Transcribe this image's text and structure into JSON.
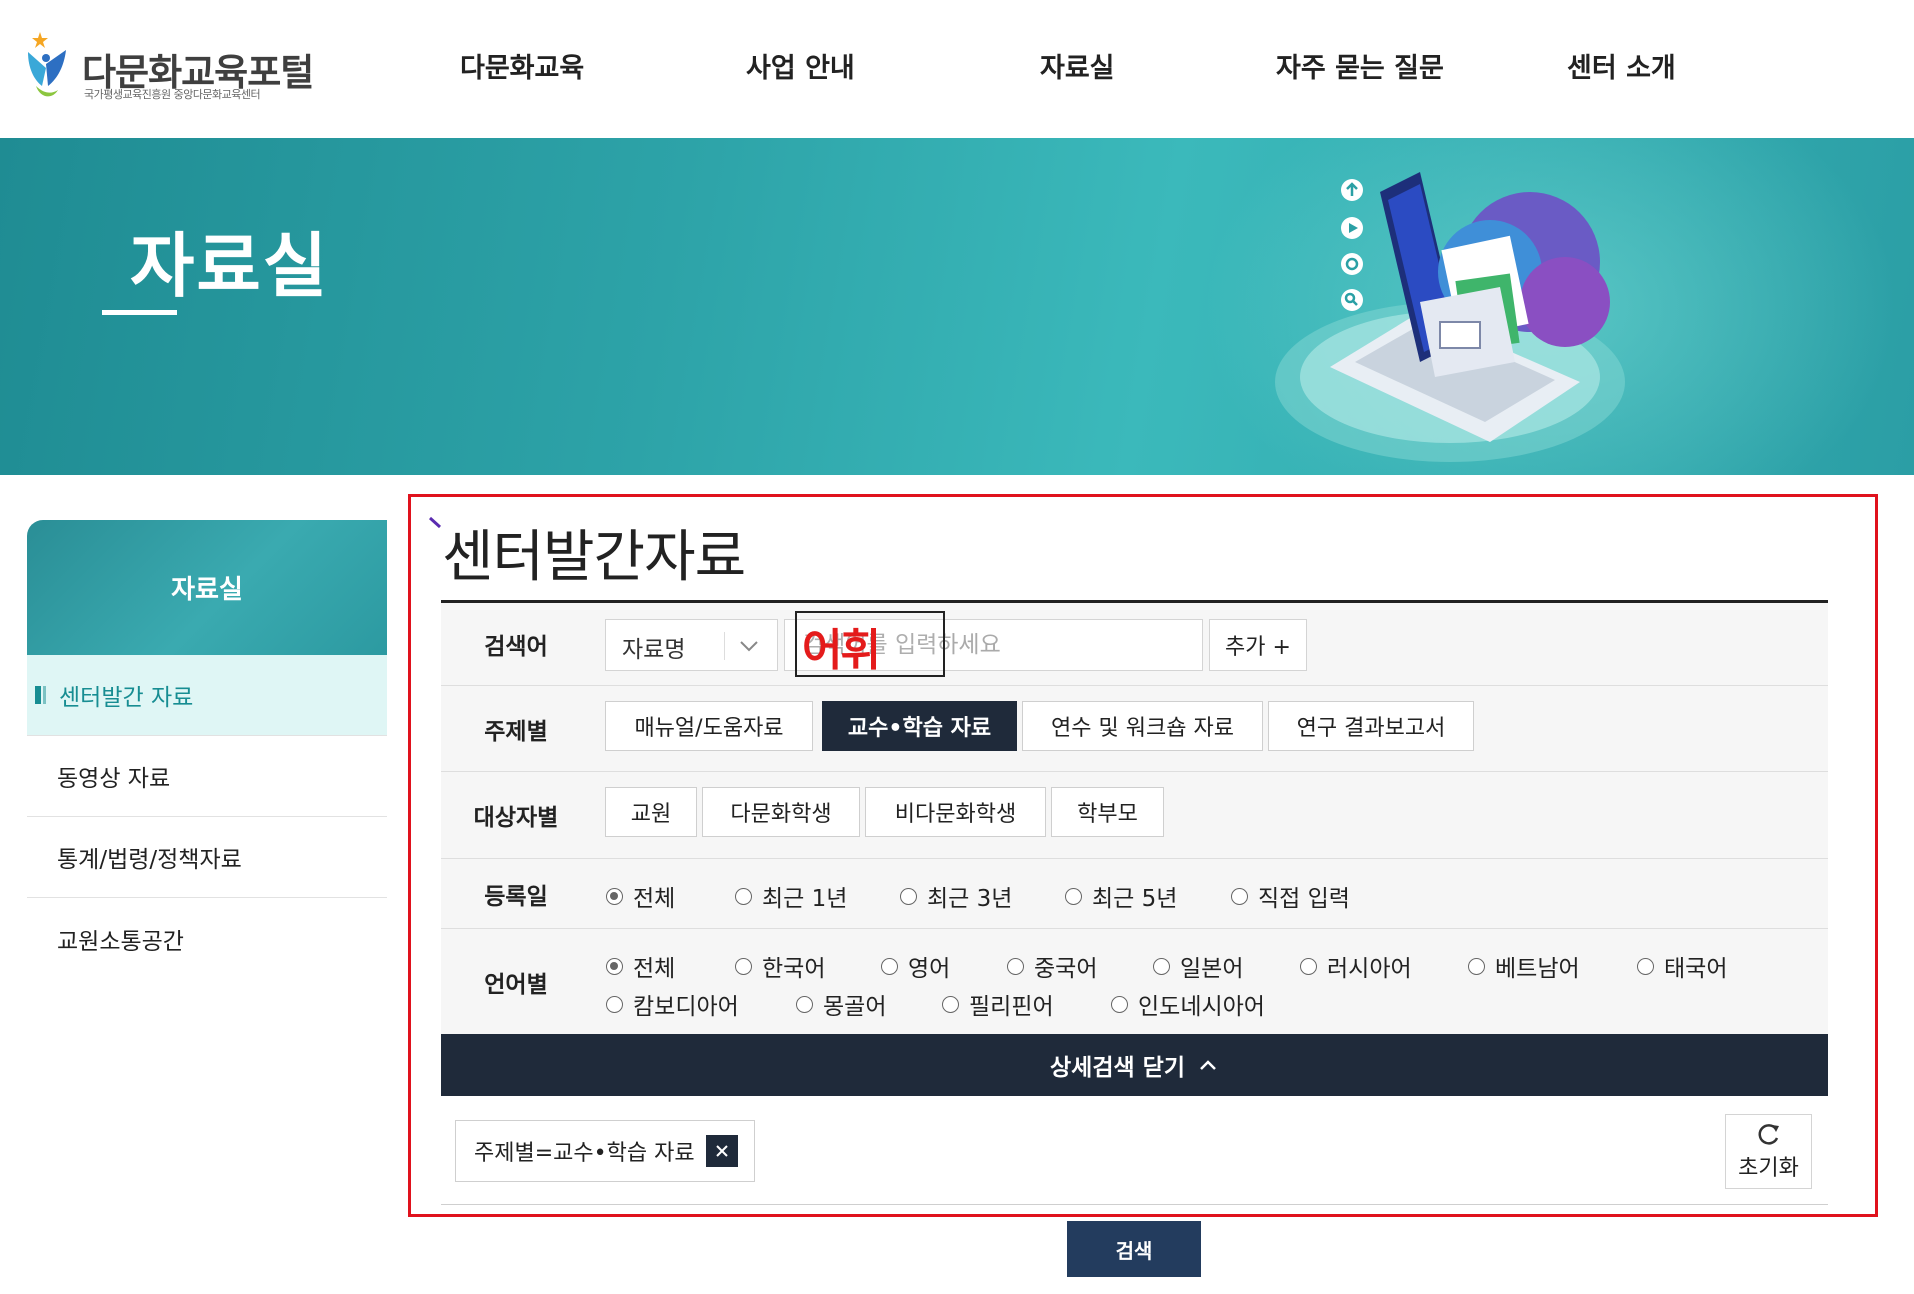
{
  "header": {
    "logo_title": "다문화교육포털",
    "logo_subtitle": "국가평생교육진흥원 중앙다문화교육센터",
    "nav": [
      "다문화교육",
      "사업 안내",
      "자료실",
      "자주 묻는 질문",
      "센터 소개"
    ]
  },
  "banner": {
    "title": "자료실"
  },
  "sidebar": {
    "title": "자료실",
    "items": [
      {
        "label": "센터발간 자료",
        "active": true
      },
      {
        "label": "동영상 자료",
        "active": false
      },
      {
        "label": "통계/법령/정책자료",
        "active": false
      },
      {
        "label": "교원소통공간",
        "active": false
      }
    ]
  },
  "page": {
    "title": "센터발간자료"
  },
  "search": {
    "label": "검색어",
    "field_value": "자료명",
    "input_placeholder": "검색어를 입력하세요",
    "add_label": "추가 +",
    "overlay_text": "어휘"
  },
  "topic": {
    "label": "주제별",
    "options": [
      "매뉴얼/도움자료",
      "교수•학습 자료",
      "연수 및 워크숍 자료",
      "연구 결과보고서"
    ],
    "selected": "교수•학습 자료"
  },
  "audience": {
    "label": "대상자별",
    "options": [
      "교원",
      "다문화학생",
      "비다문화학생",
      "학부모"
    ]
  },
  "date": {
    "label": "등록일",
    "options": [
      "전체",
      "최근 1년",
      "최근 3년",
      "최근 5년",
      "직접 입력"
    ],
    "selected": "전체"
  },
  "language": {
    "label": "언어별",
    "options": [
      "전체",
      "한국어",
      "영어",
      "중국어",
      "일본어",
      "러시아어",
      "베트남어",
      "태국어",
      "캄보디아어",
      "몽골어",
      "필리핀어",
      "인도네시아어"
    ],
    "selected": "전체"
  },
  "detail_toggle": {
    "label": "상세검색 닫기"
  },
  "active_filter": {
    "label": "주제별=교수•학습 자료"
  },
  "reset": {
    "label": "초기화"
  },
  "search_button": {
    "label": "검색"
  },
  "colors": {
    "teal": "#2da3a8",
    "navy": "#1f2a3a",
    "search_button": "#233c5e",
    "highlight_frame": "#e0121d",
    "overlay_text": "#e41b1b"
  }
}
